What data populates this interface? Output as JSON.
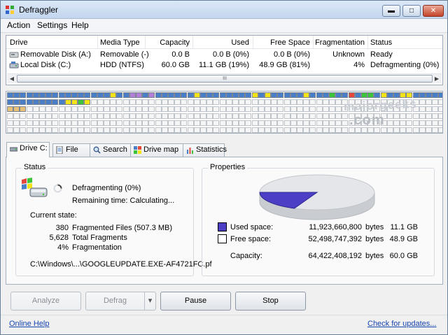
{
  "window": {
    "title": "Defraggler",
    "minimize": "▬",
    "maximize": "□",
    "close": "✕"
  },
  "menu": [
    "Action",
    "Settings",
    "Help"
  ],
  "drive_list": {
    "columns": [
      "Drive",
      "Media Type",
      "Capacity",
      "Used",
      "Free Space",
      "Fragmentation",
      "Status"
    ],
    "rows": [
      {
        "drive": "Removable Disk (A:)",
        "media": "Removable (-)",
        "capacity": "0.0 B",
        "used": "0.0 B (0%)",
        "free": "0.0 B (0%)",
        "frag": "Unknown",
        "status": "Ready"
      },
      {
        "drive": "Local Disk (C:)",
        "media": "HDD (NTFS)",
        "capacity": "60.0 GB",
        "used": "11.1 GB (19%)",
        "free": "48.9 GB (81%)",
        "frag": "4%",
        "status": "Defragmenting (0%)"
      }
    ],
    "scroll_left": "◀",
    "scroll_right": "▶",
    "scroll_grip": "III"
  },
  "colors": {
    "used_blue": "#4a7fc8",
    "fragmented": "#e4483a",
    "yellow": "#f4e21b",
    "green": "#3ec43a",
    "purple": "#b07fd6",
    "beige": "#e7c178",
    "pie_used": "#4c3fc6",
    "pie_free": "#e4e6ea"
  },
  "watermark": {
    "line1": "majorgeeks",
    "line2": ".com"
  },
  "tabs": [
    {
      "label": "Drive C:",
      "icon": "drive-icon"
    },
    {
      "label": "File list",
      "icon": "file-list-icon"
    },
    {
      "label": "Search",
      "icon": "search-icon"
    },
    {
      "label": "Drive map",
      "icon": "drive-map-icon"
    },
    {
      "label": "Statistics",
      "icon": "statistics-icon"
    }
  ],
  "status": {
    "title": "Status",
    "activity": "Defragmenting (0%)",
    "remaining": "Remaining time: Calculating...",
    "current_state_label": "Current state:",
    "stats": [
      {
        "value": "380",
        "label": "Fragmented Files (507.3 MB)"
      },
      {
        "value": "5,628",
        "label": "Total Fragments"
      },
      {
        "value": "4%",
        "label": "Fragmentation"
      }
    ],
    "current_file": "C:\\Windows\\...\\GOOGLEUPDATE.EXE-AF4721FC.pf"
  },
  "properties": {
    "title": "Properties",
    "used_fraction": 0.185,
    "used_label": "Used space:",
    "used_bytes": "11,923,660,800",
    "used_unit": "bytes",
    "used_size": "11.1 GB",
    "free_label": "Free space:",
    "free_bytes": "52,498,747,392",
    "free_unit": "bytes",
    "free_size": "48.9 GB",
    "cap_label": "Capacity:",
    "cap_bytes": "64,422,408,192",
    "cap_unit": "bytes",
    "cap_size": "60.0 GB"
  },
  "buttons": {
    "analyze": "Analyze",
    "defrag": "Defrag",
    "defrag_menu": "▾",
    "pause": "Pause",
    "stop": "Stop"
  },
  "footer": {
    "help": "Online Help",
    "updates": "Check for updates..."
  }
}
